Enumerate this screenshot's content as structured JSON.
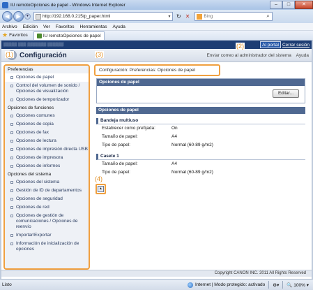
{
  "window": {
    "title": "IU remotoOpciones de papel",
    "title_suffix": "- Windows Internet Explorer",
    "url": "http://192.168.0.215/p_paper.html",
    "search_placeholder": "Bing"
  },
  "menubar": [
    "Archivo",
    "Edición",
    "Ver",
    "Favoritos",
    "Herramientas",
    "Ayuda"
  ],
  "favorites": {
    "label": "Favoritos",
    "tab_title": "IU remotoOpciones de papel"
  },
  "appbar": {
    "login_label": "Al portal",
    "logout_label": "Cerrar sesión"
  },
  "header": {
    "title": "Configuración",
    "link_email": "Enviar correo al administrador del sistema",
    "link_help": "Ayuda"
  },
  "callouts": {
    "c1": "(1)",
    "c2": "(2)",
    "c3": "(3)",
    "c4": "(4)"
  },
  "sidebar": {
    "sections": [
      {
        "title": "Preferencias",
        "items": [
          "Opciones de papel",
          "Control del volumen de sonido / Opciones de visualización",
          "Opciones de temporizador"
        ]
      },
      {
        "title": "Opciones de funciones",
        "items": [
          "Opciones comunes",
          "Opciones de copia",
          "Opciones de fax",
          "Opciones de lectura",
          "Opciones de impresión directa USB",
          "Opciones de impresora",
          "Opciones de informes"
        ]
      },
      {
        "title": "Opciones del sistema",
        "items": [
          "Opciones del sistema",
          "Gestión de ID de departamentos",
          "Opciones de seguridad",
          "Opciones de red",
          "Opciones de gestión de comunicaciones / Opciones de reenvío",
          "Importar/Exportar",
          "Información de inicialización de opciones"
        ]
      }
    ]
  },
  "main": {
    "breadcrumb": "Configuración: Preferencias: Opciones de papel",
    "panel1_title": "Opciones de papel",
    "edit_label": "Editar...",
    "panel2_title": "Opciones de papel",
    "groups": [
      {
        "title": "Bandeja multiuso",
        "rows": [
          {
            "label": "Establecer como prefijada:",
            "value": "On"
          },
          {
            "label": "Tamaño de papel:",
            "value": "A4"
          },
          {
            "label": "Tipo de papel:",
            "value": "Normal (60-89 g/m2)"
          }
        ]
      },
      {
        "title": "Casete 1",
        "rows": [
          {
            "label": "Tamaño de papel:",
            "value": "A4"
          },
          {
            "label": "Tipo de papel:",
            "value": "Normal (60-89 g/m2)"
          }
        ]
      }
    ]
  },
  "footer": {
    "copyright": "Copyright CANON INC. 2011 All Rights Reserved"
  },
  "status": {
    "left": "Listo",
    "zone": "Internet | Modo protegido: activado",
    "zoom": "100%"
  }
}
